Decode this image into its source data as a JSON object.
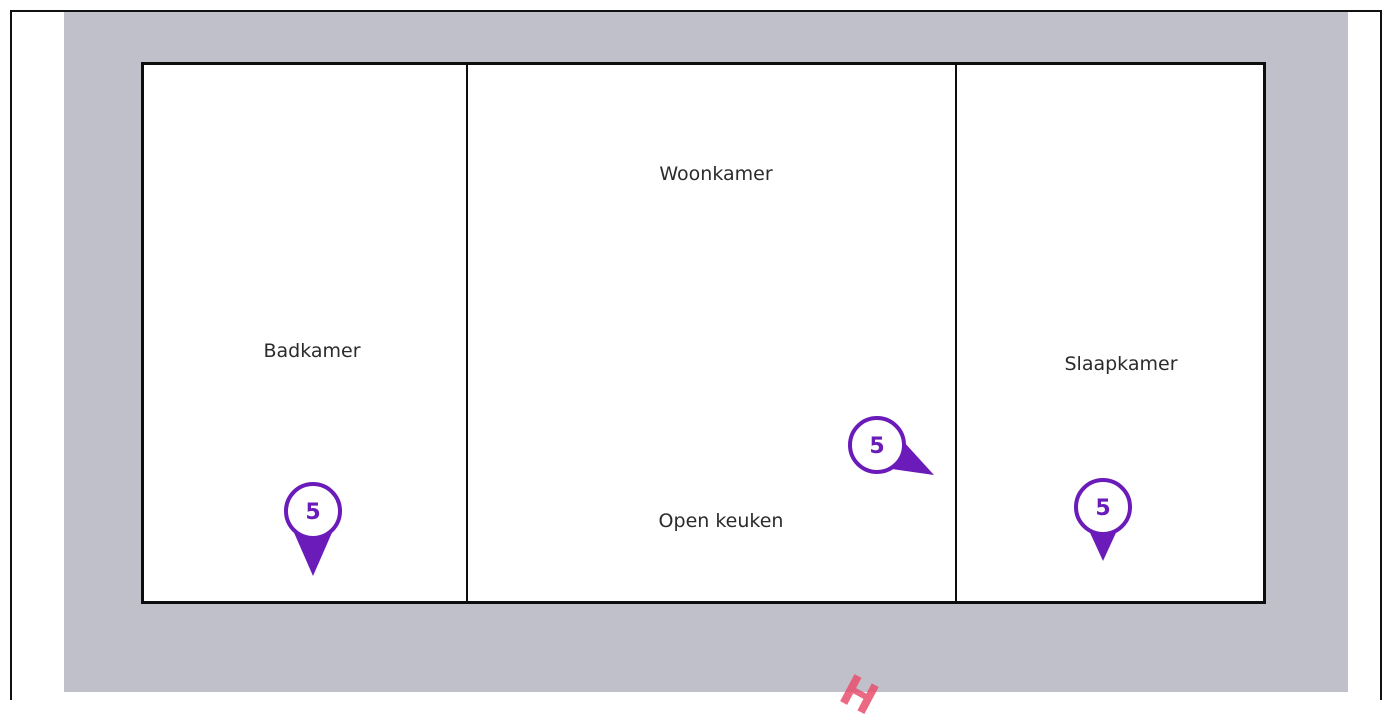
{
  "rooms": [
    {
      "name": "Badkamer"
    },
    {
      "name": "Woonkamer"
    },
    {
      "name": "Open keuken"
    },
    {
      "name": "Slaapkamer"
    }
  ],
  "markers": [
    {
      "label": "5",
      "room": "Badkamer"
    },
    {
      "label": "5",
      "room": "Open keuken"
    },
    {
      "label": "5",
      "room": "Slaapkamer"
    }
  ],
  "watermark": "H",
  "colors": {
    "marker": "#6a1bb9",
    "background": "#c0c0ca",
    "watermark": "#e8506e"
  }
}
